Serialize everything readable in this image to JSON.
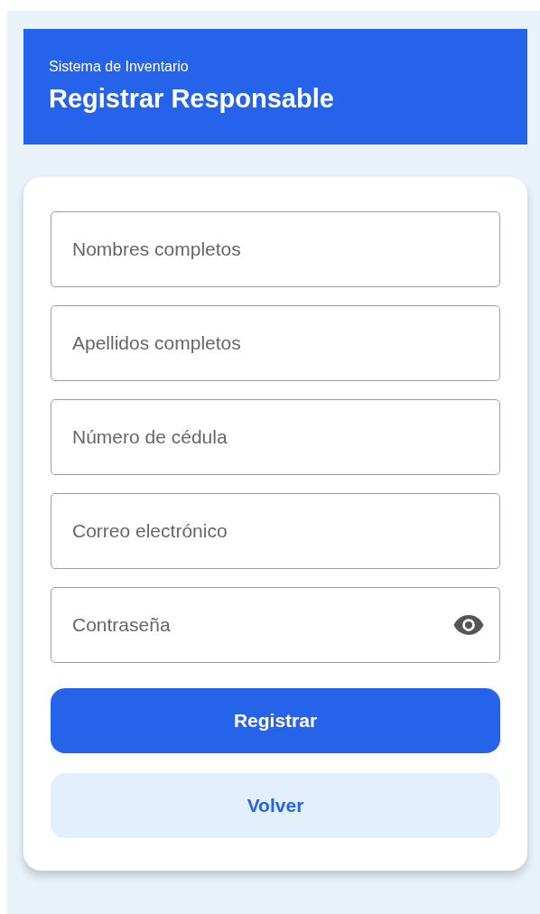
{
  "header": {
    "subtitle": "Sistema de Inventario",
    "title": "Registrar Responsable"
  },
  "fields": [
    {
      "placeholder": "Nombres completos",
      "kind": "text"
    },
    {
      "placeholder": "Apellidos completos",
      "kind": "text"
    },
    {
      "placeholder": "Número de cédula",
      "kind": "text"
    },
    {
      "placeholder": "Correo electrónico",
      "kind": "text"
    },
    {
      "placeholder": "Contraseña",
      "kind": "password"
    }
  ],
  "buttons": [
    {
      "label": "Registrar",
      "kind": "primary"
    },
    {
      "label": "Volver",
      "kind": "secondary"
    }
  ]
}
